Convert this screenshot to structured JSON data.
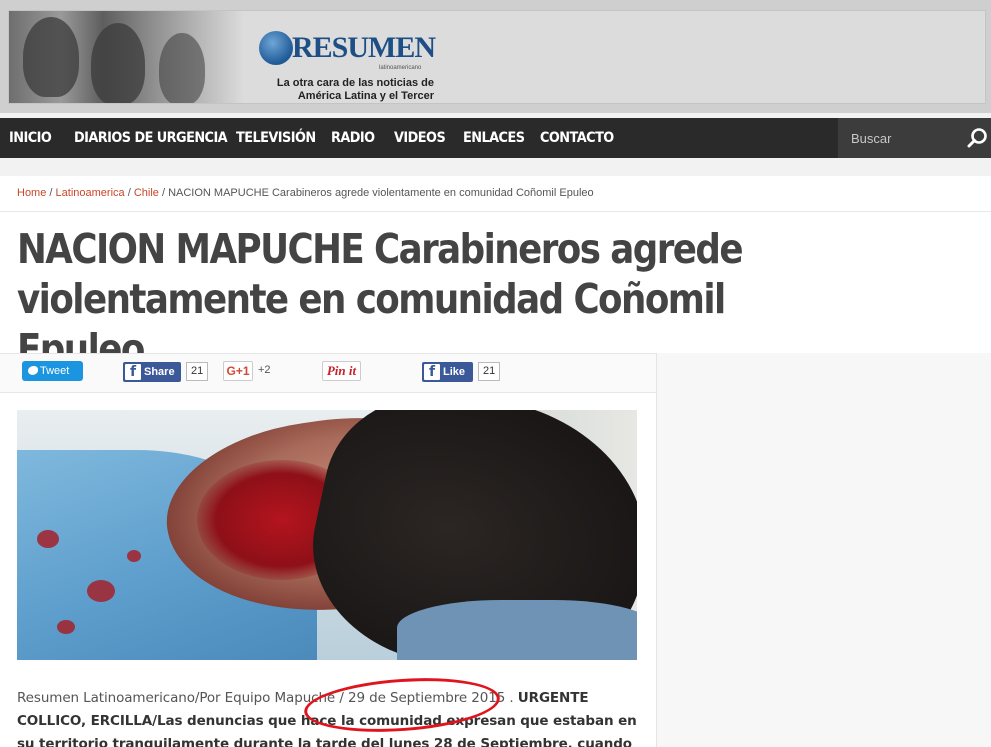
{
  "banner": {
    "logo_text": "RESUMEN",
    "logo_small": "latinoamericano",
    "tagline_line1": "La otra cara de las noticias de",
    "tagline_line2": "América Latina y el Tercer Mundo"
  },
  "nav": {
    "items": [
      "INICIO",
      "DIARIOS DE URGENCIA",
      "TELEVISIÓN",
      "RADIO",
      "VIDEOS",
      "ENLACES",
      "CONTACTO"
    ],
    "search_placeholder": "Buscar"
  },
  "breadcrumb": {
    "home": "Home",
    "section": "Latinoamerica",
    "subsection": "Chile",
    "current": "NACION MAPUCHE Carabineros agrede violentamente en comunidad Coñomil Epuleo",
    "separator": "/"
  },
  "article": {
    "title": "NACION MAPUCHE Carabineros agrede violentamente en comunidad Coñomil Epuleo",
    "byline": "Resumen Latinoamericano/Por Equipo Mapuche / 29 de Septiembre 2015 .",
    "text_bold": "URGENTE COLLICO, ERCILLA/Las denuncias que hace la comunidad expresan que estaban en su territorio tranquilamente durante la tarde del lunes 28 de Septiembre, cuando arremete un gran"
  },
  "share": {
    "tweet_label": "Tweet",
    "fb_share_label": "Share",
    "fb_share_count": "21",
    "gplus_label": "G+1",
    "gplus_count": "+2",
    "pin_label": "Pin it",
    "fb_like_label": "Like",
    "fb_like_count": "21"
  },
  "colors": {
    "nav_bg": "#2a2a2a",
    "link": "#c8462a",
    "twitter": "#1b95e0",
    "facebook": "#3b5998",
    "annotation": "#e0141c"
  }
}
